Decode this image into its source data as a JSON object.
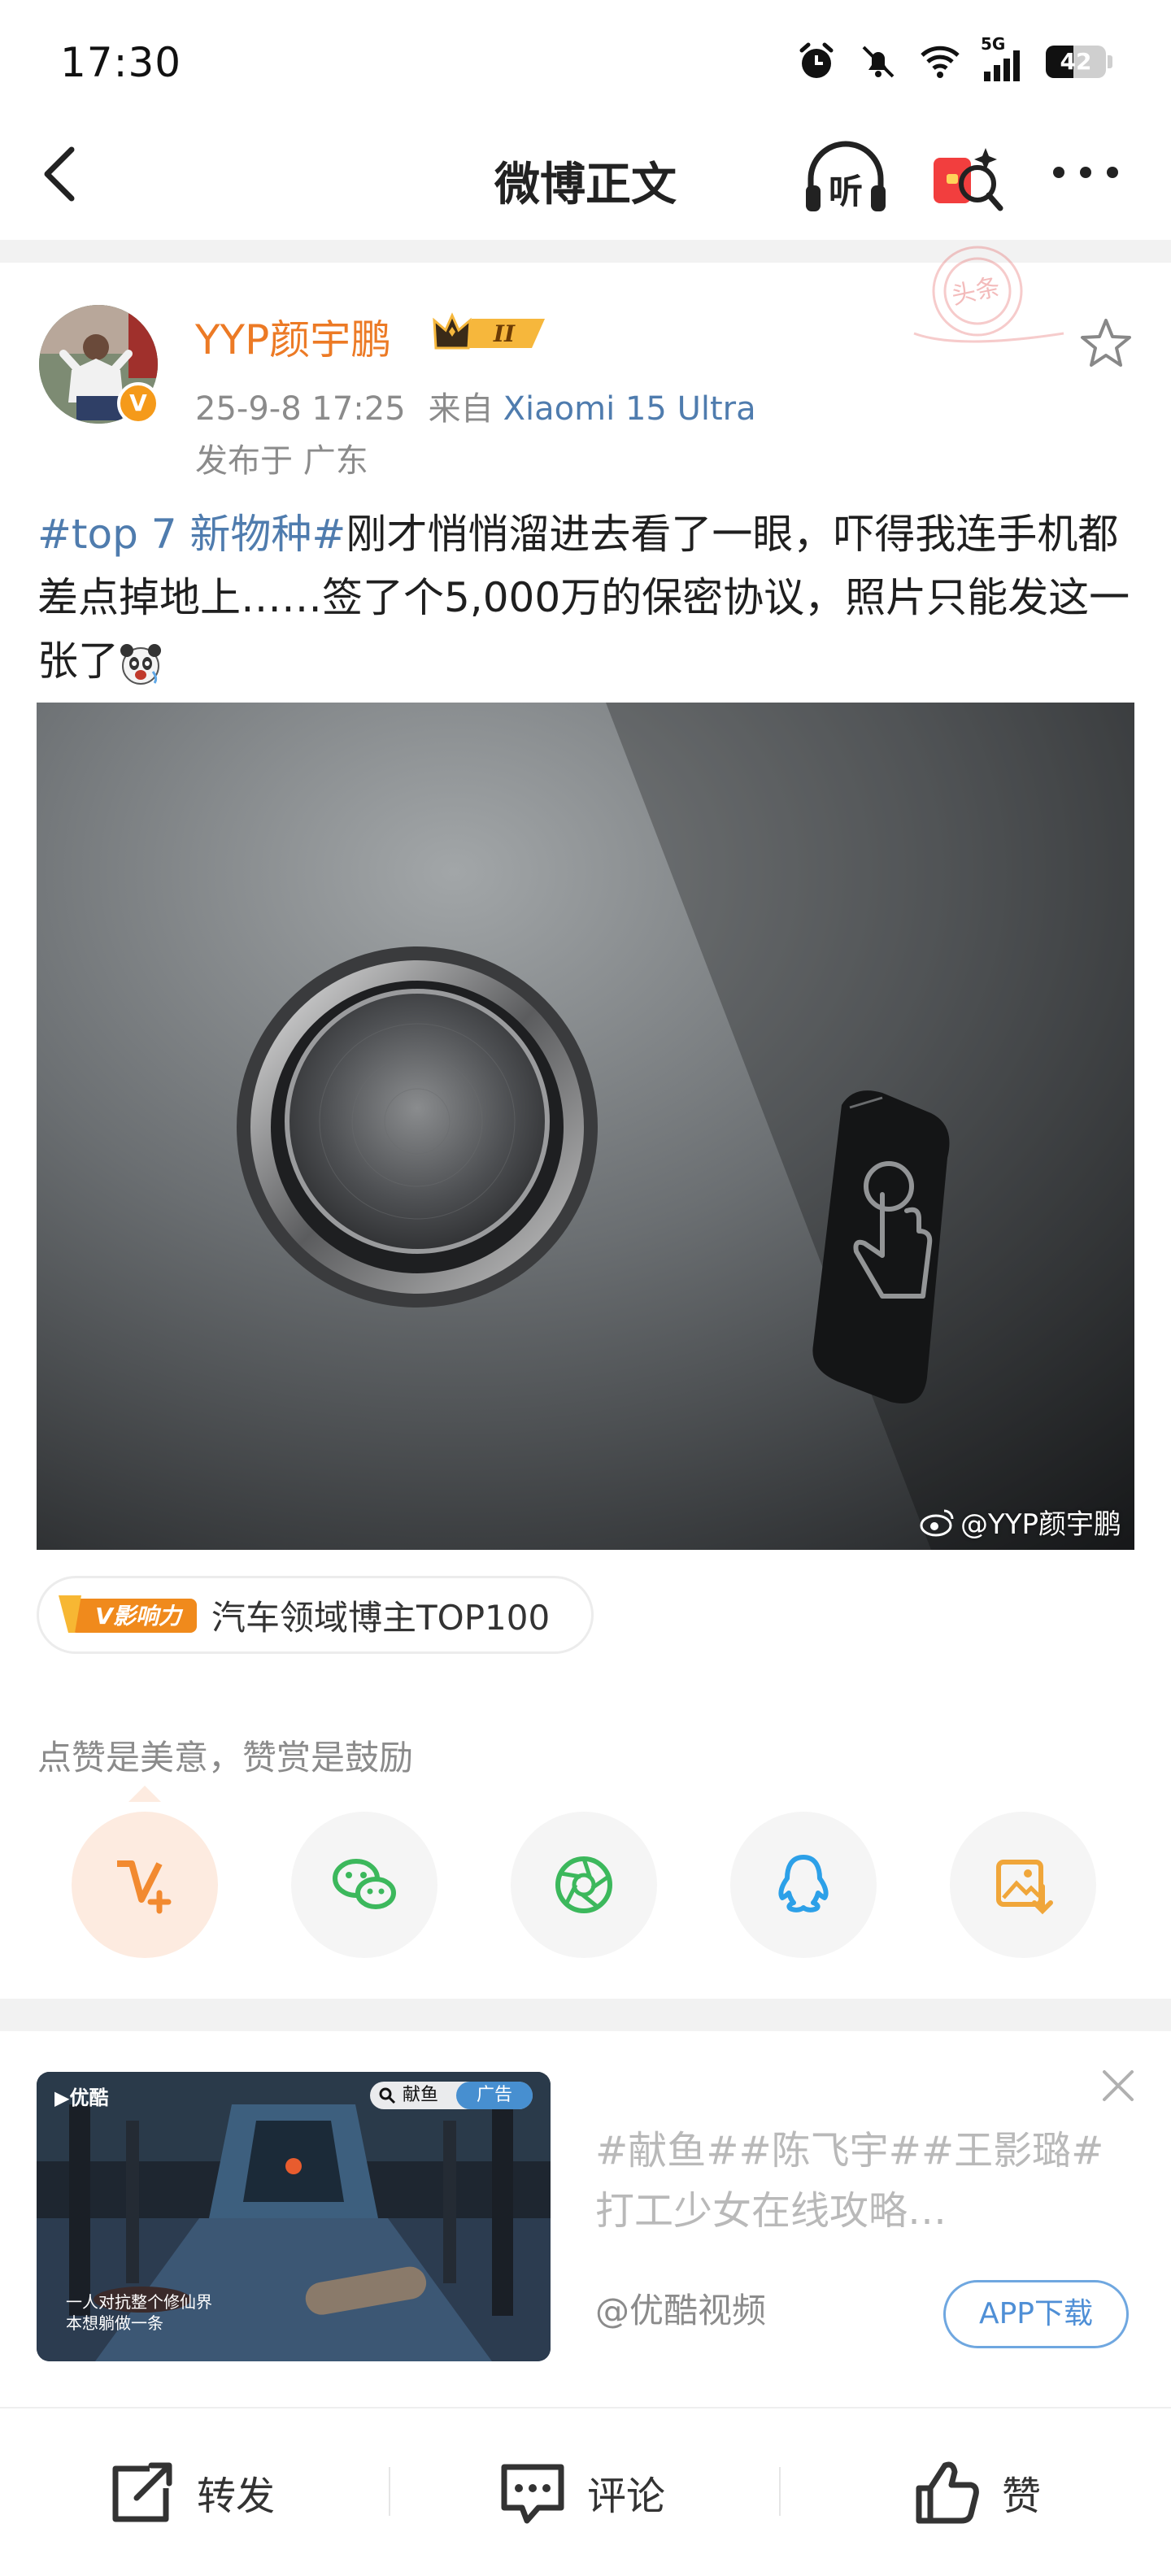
{
  "status_bar": {
    "time": "17:30",
    "network": "5G",
    "battery": "42"
  },
  "nav": {
    "title": "微博正文",
    "listen_label": "听"
  },
  "post": {
    "username": "YYP颜宇鹏",
    "level": "II",
    "date": "25-9-8 17:25",
    "from_label": "来自",
    "source": "Xiaomi 15 Ultra",
    "location": "发布于 广东",
    "stamp_text": "头条",
    "hashtag": "#top 7 新物种#",
    "body": "刚才悄悄溜进去看了一眼，吓得我连手机都差点掉地上……签了个5,000万的保密协议，照片只能发这一张了",
    "photo_watermark": "@YYP颜宇鹏",
    "influence_logo": "V影响力",
    "influence_label": "汽车领域博主TOP100",
    "like_hint": "点赞是美意，赞赏是鼓励",
    "share_icons": [
      "reward-icon",
      "wechat-icon",
      "moments-icon",
      "qq-icon",
      "save-image-icon"
    ]
  },
  "ad": {
    "app_logo": "优酷",
    "search_text": "献鱼",
    "ad_label": "广告",
    "caption_line1": "一人对抗整个修仙界",
    "caption_line2": "本想躺做一条",
    "title": "#献鱼##陈飞宇##王影璐#打工少女在线攻略…",
    "source": "@优酷视频",
    "button": "APP下载"
  },
  "bottom_bar": {
    "repost": "转发",
    "comment": "评论",
    "like": "赞"
  },
  "colors": {
    "accent": "#ec7a25",
    "link": "#4f7cae",
    "hint": "#8b8b8b"
  }
}
